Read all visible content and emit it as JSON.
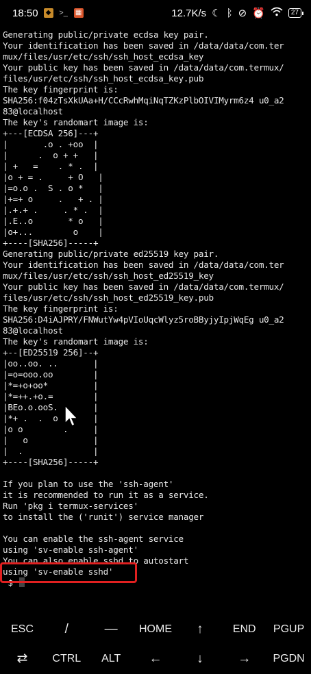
{
  "status_bar": {
    "time": "18:50",
    "speed": "12.7K/s",
    "battery": "27"
  },
  "terminal": {
    "lines": [
      "Generating public/private ecdsa key pair.",
      "Your identification has been saved in /data/data/com.ter",
      "mux/files/usr/etc/ssh/ssh_host_ecdsa_key",
      "Your public key has been saved in /data/data/com.termux/",
      "files/usr/etc/ssh/ssh_host_ecdsa_key.pub",
      "The key fingerprint is:",
      "SHA256:f04zTsXkUAa+H/CCcRwhMqiNqTZKzPlbOIVIMyrm6z4 u0_a2",
      "83@localhost",
      "The key's randomart image is:",
      "+---[ECDSA 256]---+",
      "|       .o . +oo  |",
      "|      .  o + +   |",
      "| +   =    . * .  |",
      "|o + = .     + O   |",
      "|=o.o .  S . o *   |",
      "|+=+ o     .   + . |",
      "|.+.+ .     . * .  |",
      "|.E..o       * o   |",
      "|o+...        o    |",
      "+----[SHA256]-----+",
      "Generating public/private ed25519 key pair.",
      "Your identification has been saved in /data/data/com.ter",
      "mux/files/usr/etc/ssh/ssh_host_ed25519_key",
      "Your public key has been saved in /data/data/com.termux/",
      "files/usr/etc/ssh/ssh_host_ed25519_key.pub",
      "The key fingerprint is:",
      "SHA256:D4iAJPRY/FNWutYw4pVIoUqcWlyz5roBByjyIpjWqEg u0_a2",
      "83@localhost",
      "The key's randomart image is:",
      "+--[ED25519 256]--+",
      "|oo..oo. ..       |",
      "|=o=ooo.oo        |",
      "|*=+o+oo*         |",
      "|*=++.+o.=        |",
      "|BEo.o.ooS.       |",
      "|*+ .  .  o       |",
      "|o o        .     |",
      "|   o             |",
      "|  .              |",
      "+----[SHA256]-----+",
      "",
      "If you plan to use the 'ssh-agent'",
      "it is recommended to run it as a service.",
      "Run 'pkg i termux-services'",
      "to install the ('runit') service manager",
      "",
      "You can enable the ssh-agent service",
      "using 'sv-enable ssh-agent'",
      "You can also enable sshd to autostart",
      "using 'sv-enable sshd'"
    ],
    "prompt": " $ "
  },
  "extra_keys": {
    "row1": [
      "ESC",
      "/",
      "—",
      "HOME",
      "↑",
      "END",
      "PGUP"
    ],
    "row2": [
      "⇄",
      "CTRL",
      "ALT",
      "←",
      "↓",
      "→",
      "PGDN"
    ]
  }
}
